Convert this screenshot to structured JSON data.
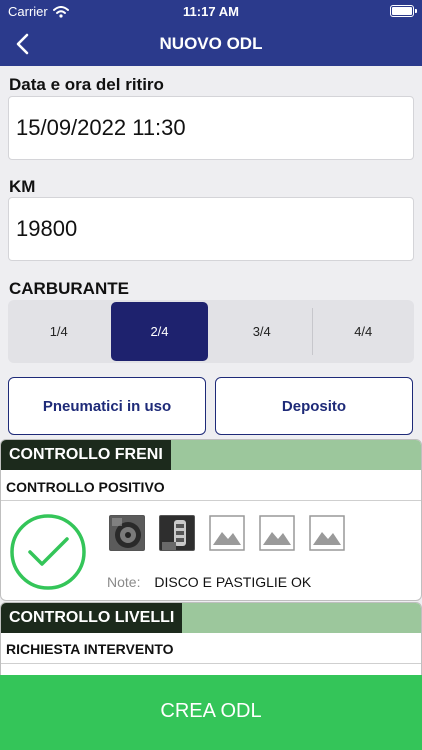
{
  "status_bar": {
    "carrier": "Carrier",
    "time": "11:17 AM"
  },
  "nav": {
    "title": "NUOVO ODL",
    "back_icon": "chevron-left-icon"
  },
  "form": {
    "pickup_label": "Data e ora del ritiro",
    "pickup_value": "15/09/2022 11:30",
    "km_label": "KM",
    "km_value": "19800",
    "fuel_label": "CARBURANTE",
    "fuel_options": [
      "1/4",
      "2/4",
      "3/4",
      "4/4"
    ],
    "fuel_selected": "2/4"
  },
  "buttons": {
    "tyres": "Pneumatici in uso",
    "deposit": "Deposito"
  },
  "check_brakes": {
    "title": "CONTROLLO FRENI",
    "result": "CONTROLLO POSITIVO",
    "status_icon": "check-circle-icon",
    "note_label": "Note:",
    "note_value": "DISCO E PASTIGLIE OK",
    "photos_filled": 2,
    "photo_slots": 5
  },
  "check_levels": {
    "title": "CONTROLLO LIVELLI",
    "result": "RICHIESTA INTERVENTO"
  },
  "footer": {
    "submit": "CREA ODL"
  },
  "colors": {
    "header": "#2b3a8c",
    "segment_selected": "#1e226e",
    "card_header": "#9cc79c",
    "card_tag": "#1c2a1c",
    "check_green": "#34c559",
    "submit": "#34c559"
  }
}
